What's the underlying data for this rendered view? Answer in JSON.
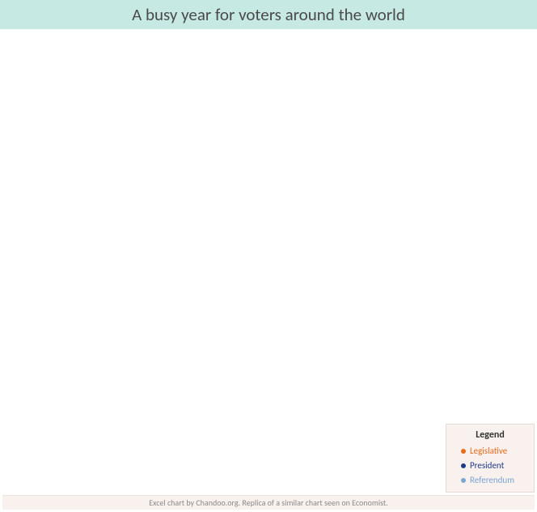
{
  "header": {
    "title": "A busy year for voters around the world"
  },
  "legend": {
    "title": "Legend",
    "items": [
      {
        "label": "Legislative",
        "color": "#e86a1a"
      },
      {
        "label": "President",
        "color": "#1e3b8a"
      },
      {
        "label": "Referendum",
        "color": "#7ba5d3"
      }
    ]
  },
  "footer": {
    "credit": "Excel chart by Chandoo.org. Replica of a similar chart seen on Economist."
  },
  "chart_data": {
    "type": "scatter",
    "title": "A busy year for voters around the world",
    "series": [
      {
        "name": "Legislative",
        "color": "#e86a1a",
        "values": []
      },
      {
        "name": "President",
        "color": "#1e3b8a",
        "values": []
      },
      {
        "name": "Referendum",
        "color": "#7ba5d3",
        "values": []
      }
    ],
    "xlabel": "",
    "ylabel": "",
    "note": "Plot area is empty in the source image; no data points are rendered."
  }
}
